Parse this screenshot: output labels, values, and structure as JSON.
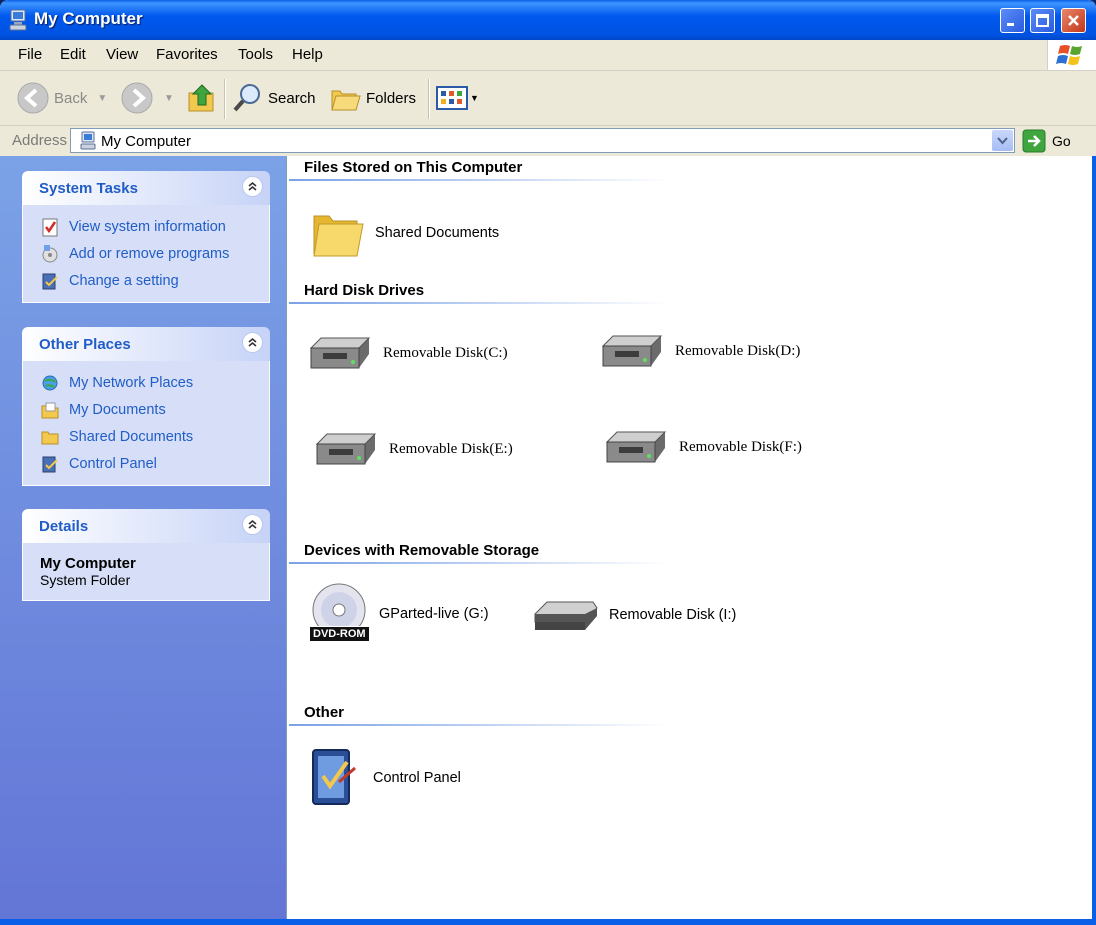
{
  "window": {
    "title": "My Computer"
  },
  "menu": [
    "File",
    "Edit",
    "View",
    "Favorites",
    "Tools",
    "Help"
  ],
  "toolbar": {
    "back_label": "Back",
    "search_label": "Search",
    "folders_label": "Folders"
  },
  "address": {
    "label": "Address",
    "value": "My Computer",
    "go_label": "Go"
  },
  "sidebar": {
    "system_tasks": {
      "title": "System Tasks",
      "items": [
        "View system information",
        "Add or remove programs",
        "Change a setting"
      ]
    },
    "other_places": {
      "title": "Other Places",
      "items": [
        "My Network Places",
        "My Documents",
        "Shared Documents",
        "Control Panel"
      ]
    },
    "details": {
      "title": "Details",
      "name": "My Computer",
      "type": "System Folder"
    }
  },
  "groups": {
    "files": {
      "title": "Files Stored on This Computer",
      "items": [
        "Shared Documents"
      ]
    },
    "hdd": {
      "title": "Hard Disk Drives",
      "items": [
        "Removable Disk(C:)",
        "Removable Disk(D:)",
        "Removable Disk(E:)",
        "Removable Disk(F:)"
      ]
    },
    "removable": {
      "title": "Devices with Removable Storage",
      "items": [
        "GParted-live (G:)",
        "Removable Disk (I:)"
      ],
      "dvd_badge": "DVD-ROM"
    },
    "other": {
      "title": "Other",
      "items": [
        "Control Panel"
      ]
    }
  },
  "colors": {
    "title_bar": "#0058ee",
    "side_pane_top": "#7ba2e7",
    "side_pane_bottom": "#6375d6",
    "link": "#215dc6"
  }
}
